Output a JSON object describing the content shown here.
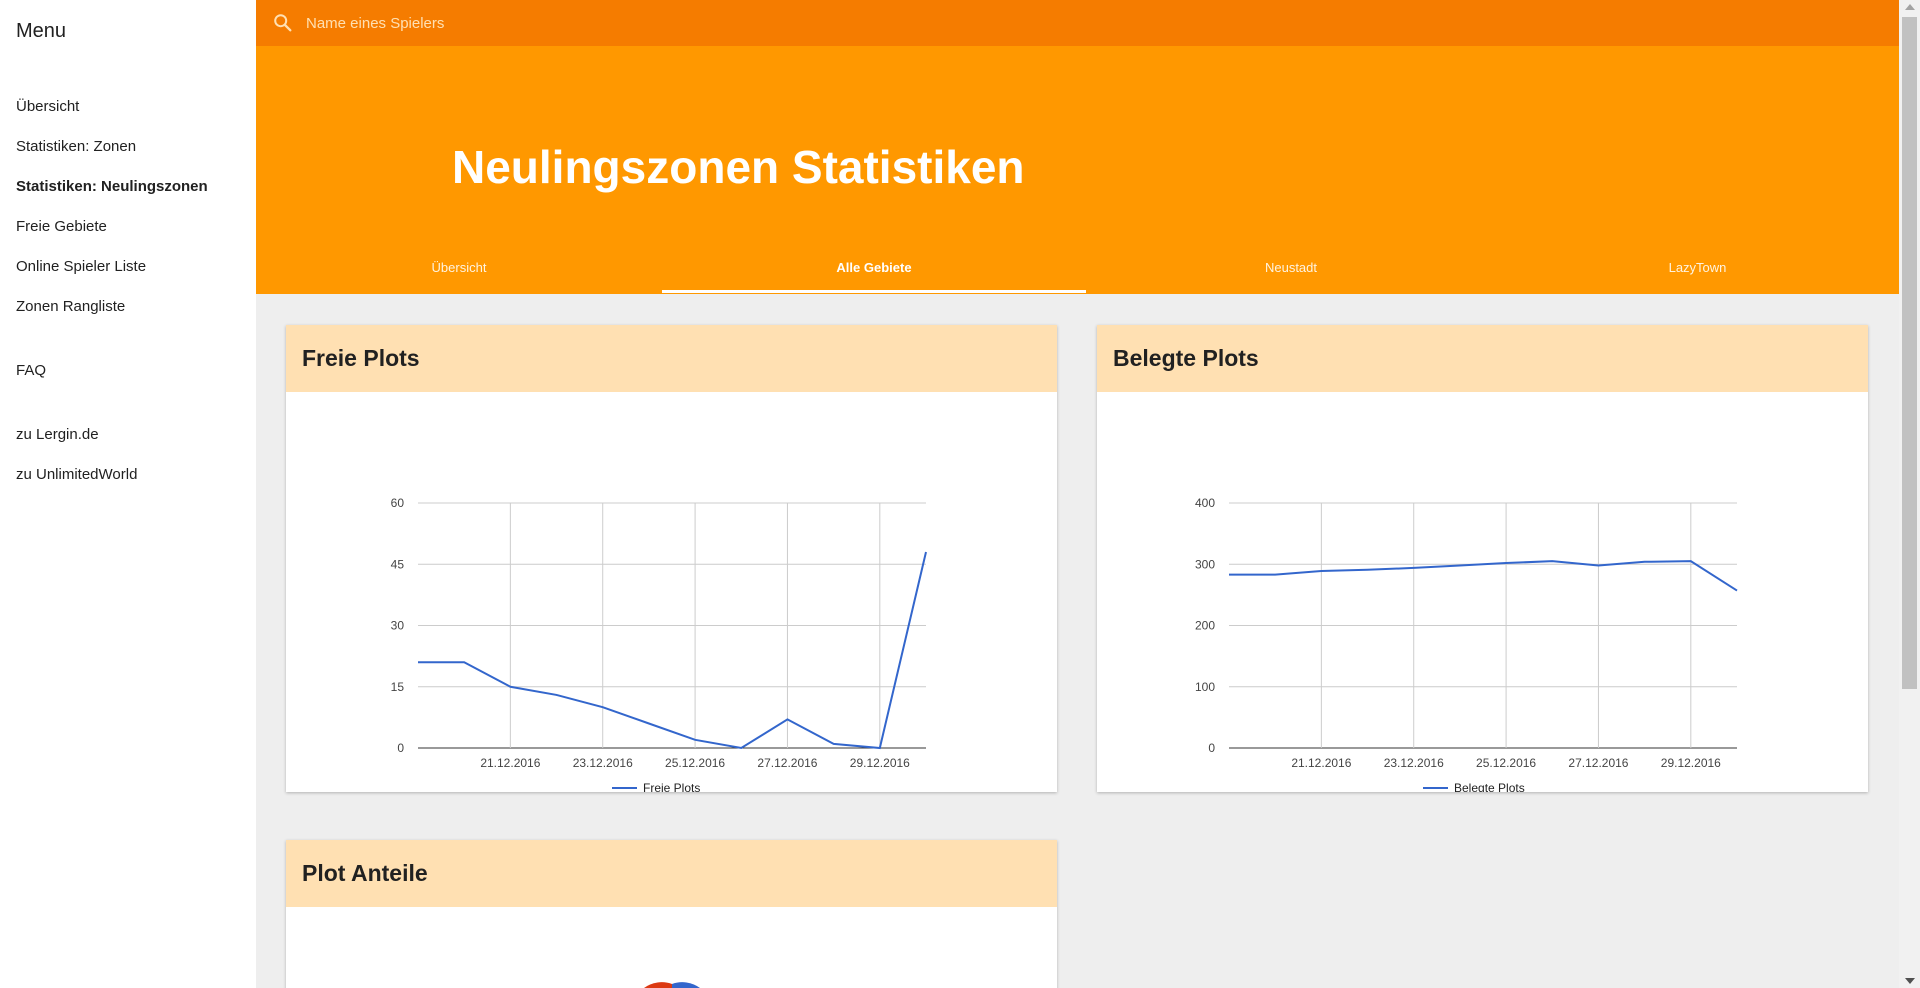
{
  "sidebar": {
    "title": "Menu",
    "items": [
      {
        "label": "Übersicht"
      },
      {
        "label": "Statistiken: Zonen"
      },
      {
        "label": "Statistiken: Neulingszonen"
      },
      {
        "label": "Freie Gebiete"
      },
      {
        "label": "Online Spieler Liste"
      },
      {
        "label": "Zonen Rangliste"
      },
      {
        "label": "FAQ"
      },
      {
        "label": "zu Lergin.de"
      },
      {
        "label": "zu UnlimitedWorld"
      }
    ],
    "active_item": "Statistiken: Neulingszonen"
  },
  "search": {
    "placeholder": "Name eines Spielers",
    "icon": "search-icon"
  },
  "header": {
    "title": "Neulingszonen Statistiken",
    "tabs": [
      {
        "label": "Übersicht"
      },
      {
        "label": "Alle Gebiete"
      },
      {
        "label": "Neustadt"
      },
      {
        "label": "LazyTown"
      }
    ],
    "active_tab": "Alle Gebiete"
  },
  "colors": {
    "accent": "#ff9800",
    "accent_dark": "#f57c00",
    "card_header": "#ffe0b2",
    "line": "#3366cc"
  },
  "cards": [
    {
      "title": "Freie Plots"
    },
    {
      "title": "Belegte Plots"
    },
    {
      "title": "Plot Anteile"
    }
  ],
  "chart_data": [
    {
      "type": "line",
      "title": "",
      "xlabel": "",
      "ylabel": "",
      "x": [
        "19.12.2016",
        "20.12.2016",
        "21.12.2016",
        "22.12.2016",
        "23.12.2016",
        "24.12.2016",
        "25.12.2016",
        "26.12.2016",
        "27.12.2016",
        "28.12.2016",
        "29.12.2016",
        "30.12.2016"
      ],
      "x_ticks": [
        "21.12.2016",
        "23.12.2016",
        "25.12.2016",
        "27.12.2016",
        "29.12.2016"
      ],
      "y_ticks": [
        0,
        15,
        30,
        45,
        60
      ],
      "ylim": [
        0,
        60
      ],
      "series": [
        {
          "name": "Freie Plots",
          "values": [
            21,
            21,
            15,
            13,
            10,
            6,
            2,
            0,
            7,
            1,
            0,
            48
          ]
        }
      ],
      "grid": true,
      "legend": "bottom"
    },
    {
      "type": "line",
      "title": "",
      "xlabel": "",
      "ylabel": "",
      "x": [
        "19.12.2016",
        "20.12.2016",
        "21.12.2016",
        "22.12.2016",
        "23.12.2016",
        "24.12.2016",
        "25.12.2016",
        "26.12.2016",
        "27.12.2016",
        "28.12.2016",
        "29.12.2016",
        "30.12.2016"
      ],
      "x_ticks": [
        "21.12.2016",
        "23.12.2016",
        "25.12.2016",
        "27.12.2016",
        "29.12.2016"
      ],
      "y_ticks": [
        0,
        100,
        200,
        300,
        400
      ],
      "ylim": [
        0,
        400
      ],
      "series": [
        {
          "name": "Belegte Plots",
          "values": [
            283,
            283,
            289,
            291,
            294,
            298,
            302,
            305,
            298,
            304,
            305,
            257
          ]
        }
      ],
      "grid": true,
      "legend": "bottom"
    }
  ]
}
